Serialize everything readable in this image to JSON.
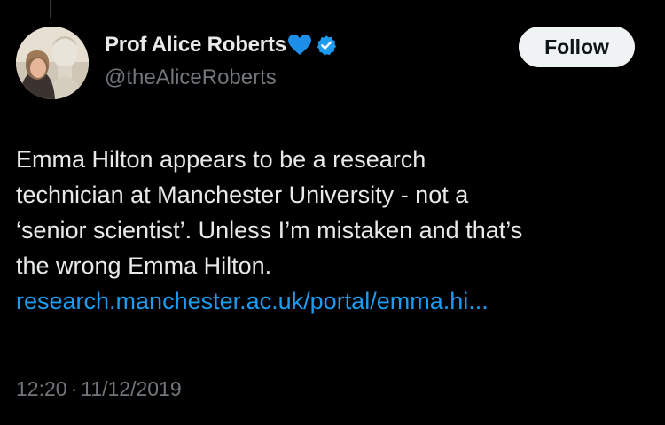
{
  "author": {
    "display_name": "Prof Alice Roberts",
    "handle": "@theAliceRoberts",
    "emoji_icon": "blue-heart-icon",
    "verified_icon": "verified-badge-icon",
    "verified_color": "#1d9bf0"
  },
  "follow": {
    "label": "Follow"
  },
  "tweet": {
    "lines": [
      "Emma Hilton appears to be a research",
      "technician at Manchester University - not a",
      "‘senior scientist’. Unless I’m mistaken and that’s",
      "the wrong Emma Hilton."
    ],
    "link_text": "research.manchester.ac.uk/portal/emma.hi..."
  },
  "meta": {
    "time": "12:20",
    "separator": "·",
    "date": "11/12/2019"
  },
  "colors": {
    "background": "#000000",
    "text": "#e7e9ea",
    "muted": "#71767b",
    "link": "#1d9bf0",
    "button_bg": "#eff3f4"
  }
}
